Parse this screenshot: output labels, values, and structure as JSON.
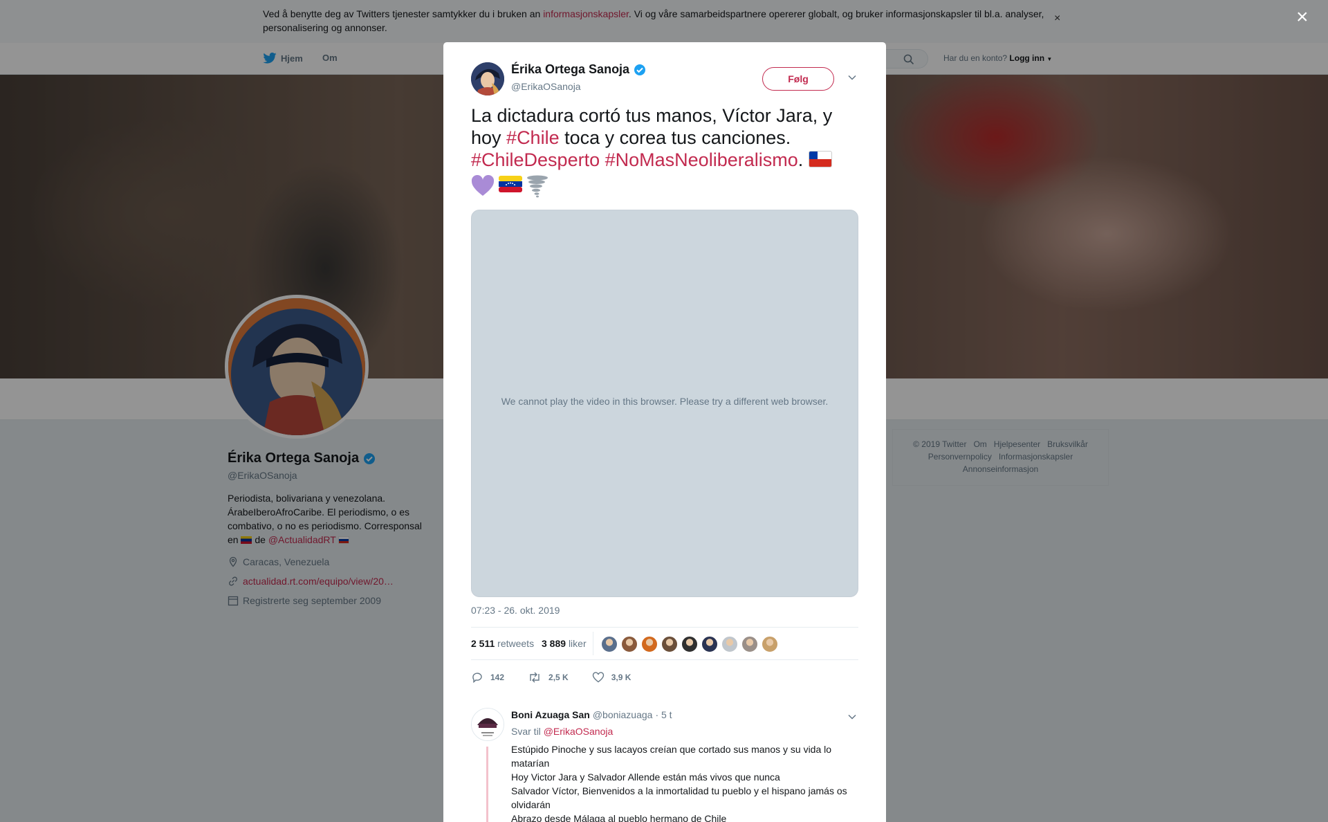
{
  "cookie_banner": {
    "text_before": "Ved å benytte deg av Twitters tjenester samtykker du i bruken an ",
    "link": "informasjonskapsler",
    "text_after": ". Vi og våre samarbeidspartnere opererer globalt, og bruker informasjonskapsler til bl.a. analyser, personalisering og annonser.",
    "close": "×"
  },
  "nav": {
    "home": "Hjem",
    "about": "Om",
    "account_prompt": "Har du en konto?",
    "login": "Logg inn"
  },
  "profile": {
    "name": "Érika Ortega Sanoja",
    "handle": "@ErikaOSanoja",
    "bio_1": "Periodista, bolivariana y venezolana. ÁrabeIberoAfroCaribe. El periodismo, o es combativo, o no es periodismo. Corresponsal en ",
    "bio_2": " de ",
    "bio_mention": "@ActualidadRT",
    "location": "Caracas, Venezuela",
    "website": "actualidad.rt.com/equipo/view/20…",
    "joined": "Registrerte seg september 2009"
  },
  "footer": {
    "links": [
      "© 2019 Twitter",
      "Om",
      "Hjelpesenter",
      "Bruksvilkår",
      "Personvernpolicy",
      "Informasjonskapsler",
      "Annonseinformasjon"
    ]
  },
  "modal_close": "×",
  "tweet": {
    "name": "Érika Ortega Sanoja",
    "handle": "@ErikaOSanoja",
    "follow": "Følg",
    "text_1": "La dictadura cortó tus manos, Víctor Jara, y hoy ",
    "hashtag_1": "#Chile",
    "text_2": " toca y corea tus canciones. ",
    "hashtag_2": "#ChileDesperto",
    "hashtag_3": "#NoMasNeoliberalismo",
    "text_3": ". ",
    "video_message": "We cannot play the video in this browser. Please try a different web browser.",
    "timestamp": "07:23 - 26. okt. 2019",
    "retweets_count": "2 511",
    "retweets_label": "retweets",
    "likes_count": "3 889",
    "likes_label": "liker",
    "replies_action": "142",
    "retweets_action": "2,5 K",
    "likes_action": "3,9 K",
    "liker_colors": [
      "#5a6f8c",
      "#8a5a3c",
      "#d2691e",
      "#6b4f3a",
      "#2f2f2f",
      "#2a3352",
      "#c0c6cc",
      "#9a8f88",
      "#c8a06a"
    ]
  },
  "reply": {
    "name": "Boni Azuaga San",
    "handle": "@boniazuaga",
    "time": "· 5 t",
    "reply_to_label": "Svar til",
    "reply_to_mention": "@ErikaOSanoja",
    "line_1": "Estúpido Pinoche y sus lacayos creían que cortado sus manos y su vida lo matarían",
    "line_2": "Hoy Victor Jara y Salvador Allende están más vivos que nunca",
    "line_3": "Salvador Víctor, Bienvenidos a la inmortalidad tu pueblo y el hispano jamás os olvidarán",
    "line_4": "Abrazo desde Málaga al pueblo hermano de Chile"
  },
  "colors": {
    "accent": "#c22a4f",
    "verified": "#1da1f2"
  }
}
